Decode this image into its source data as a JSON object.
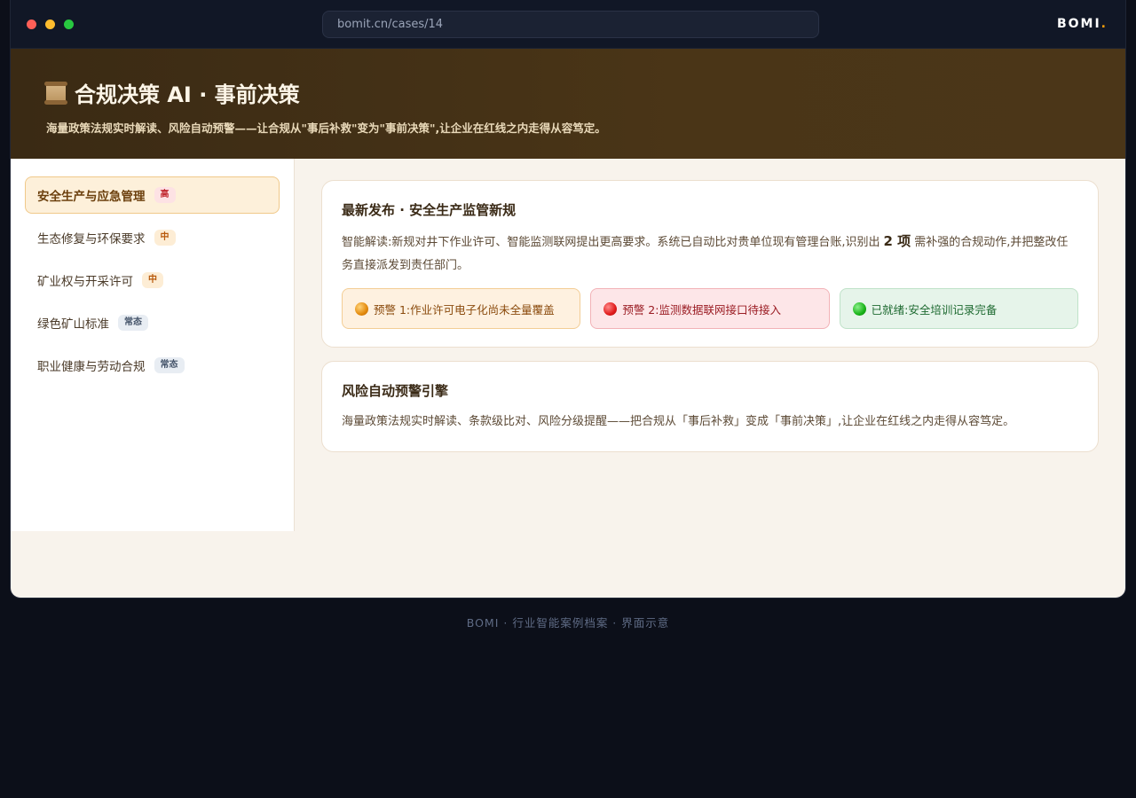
{
  "browser": {
    "url": "bomit.cn/cases/14",
    "brand": "BOMI",
    "brand_dot": "."
  },
  "hero": {
    "icon": "scroll-icon",
    "title": "合规决策 AI · 事前决策",
    "subtitle": "海量政策法规实时解读、风险自动预警——让合规从\"事后补救\"变为\"事前决策\",让企业在红线之内走得从容笃定。"
  },
  "sidebar": {
    "items": [
      {
        "label": "安全生产与应急管理",
        "badge": "高",
        "level": "high",
        "active": true
      },
      {
        "label": "生态修复与环保要求",
        "badge": "中",
        "level": "mid",
        "active": false
      },
      {
        "label": "矿业权与开采许可",
        "badge": "中",
        "level": "mid",
        "active": false
      },
      {
        "label": "绿色矿山标准",
        "badge": "常态",
        "level": "normal",
        "active": false
      },
      {
        "label": "职业健康与劳动合规",
        "badge": "常态",
        "level": "normal",
        "active": false
      }
    ]
  },
  "main": {
    "card1": {
      "title": "最新发布 · 安全生产监管新规",
      "text_before": "智能解读:新规对井下作业许可、智能监测联网提出更高要求。系统已自动比对贵单位现有管理台账,识别出",
      "highlight": "2 项",
      "text_after": "需补强的合规动作,并把整改任务直接派发到责任部门。",
      "alerts": [
        {
          "type": "warn",
          "icon": "orange-circle-icon",
          "text": "预警 1:作业许可电子化尚未全量覆盖"
        },
        {
          "type": "danger",
          "icon": "red-circle-icon",
          "text": "预警 2:监测数据联网接口待接入"
        },
        {
          "type": "ok",
          "icon": "green-circle-icon",
          "text": "已就绪:安全培训记录完备"
        }
      ]
    },
    "card2": {
      "title": "风险自动预警引擎",
      "text": "海量政策法规实时解读、条款级比对、风险分级提醒——把合规从「事后补救」变成「事前决策」,让企业在红线之内走得从容笃定。"
    }
  },
  "footer": {
    "text": "BOMI · 行业智能案例档案 · 界面示意"
  },
  "colors": {
    "accent": "#f59e0b",
    "hero_bg": "#4a3517",
    "page_bg": "#0c0f19"
  }
}
